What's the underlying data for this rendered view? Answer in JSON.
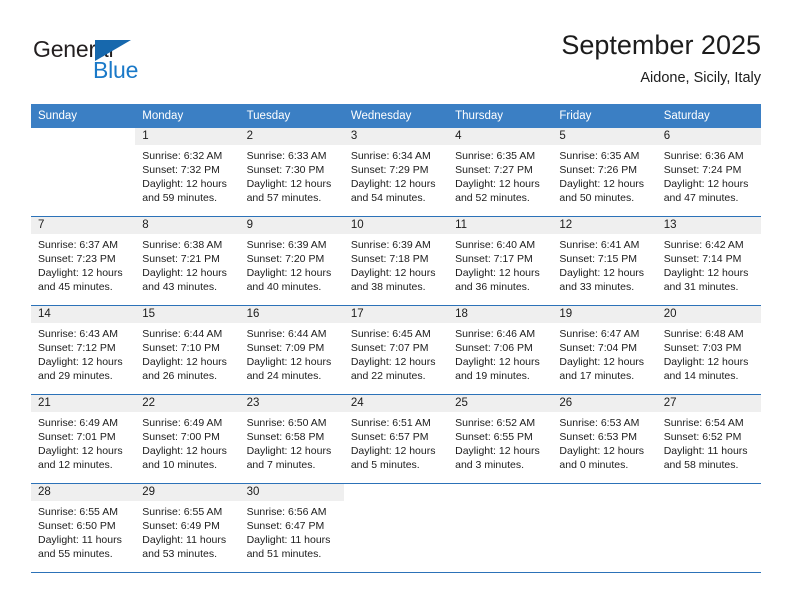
{
  "brand": {
    "name_dark": "General",
    "name_blue": "Blue",
    "accent_color": "#1a79c8",
    "triangle_color": "#1768ad"
  },
  "header": {
    "title": "September 2025",
    "location": "Aidone, Sicily, Italy"
  },
  "theme": {
    "header_bg": "#3b7fc4",
    "header_text": "#ffffff",
    "daynum_bg": "#efefef",
    "row_divider": "#2c72b8",
    "body_text": "#1c1c1c"
  },
  "weekday_headers": [
    "Sunday",
    "Monday",
    "Tuesday",
    "Wednesday",
    "Thursday",
    "Friday",
    "Saturday"
  ],
  "weeks": [
    [
      {
        "day": "",
        "sunrise": "",
        "sunset": "",
        "daylight1": "",
        "daylight2": ""
      },
      {
        "day": "1",
        "sunrise": "Sunrise: 6:32 AM",
        "sunset": "Sunset: 7:32 PM",
        "daylight1": "Daylight: 12 hours",
        "daylight2": "and 59 minutes."
      },
      {
        "day": "2",
        "sunrise": "Sunrise: 6:33 AM",
        "sunset": "Sunset: 7:30 PM",
        "daylight1": "Daylight: 12 hours",
        "daylight2": "and 57 minutes."
      },
      {
        "day": "3",
        "sunrise": "Sunrise: 6:34 AM",
        "sunset": "Sunset: 7:29 PM",
        "daylight1": "Daylight: 12 hours",
        "daylight2": "and 54 minutes."
      },
      {
        "day": "4",
        "sunrise": "Sunrise: 6:35 AM",
        "sunset": "Sunset: 7:27 PM",
        "daylight1": "Daylight: 12 hours",
        "daylight2": "and 52 minutes."
      },
      {
        "day": "5",
        "sunrise": "Sunrise: 6:35 AM",
        "sunset": "Sunset: 7:26 PM",
        "daylight1": "Daylight: 12 hours",
        "daylight2": "and 50 minutes."
      },
      {
        "day": "6",
        "sunrise": "Sunrise: 6:36 AM",
        "sunset": "Sunset: 7:24 PM",
        "daylight1": "Daylight: 12 hours",
        "daylight2": "and 47 minutes."
      }
    ],
    [
      {
        "day": "7",
        "sunrise": "Sunrise: 6:37 AM",
        "sunset": "Sunset: 7:23 PM",
        "daylight1": "Daylight: 12 hours",
        "daylight2": "and 45 minutes."
      },
      {
        "day": "8",
        "sunrise": "Sunrise: 6:38 AM",
        "sunset": "Sunset: 7:21 PM",
        "daylight1": "Daylight: 12 hours",
        "daylight2": "and 43 minutes."
      },
      {
        "day": "9",
        "sunrise": "Sunrise: 6:39 AM",
        "sunset": "Sunset: 7:20 PM",
        "daylight1": "Daylight: 12 hours",
        "daylight2": "and 40 minutes."
      },
      {
        "day": "10",
        "sunrise": "Sunrise: 6:39 AM",
        "sunset": "Sunset: 7:18 PM",
        "daylight1": "Daylight: 12 hours",
        "daylight2": "and 38 minutes."
      },
      {
        "day": "11",
        "sunrise": "Sunrise: 6:40 AM",
        "sunset": "Sunset: 7:17 PM",
        "daylight1": "Daylight: 12 hours",
        "daylight2": "and 36 minutes."
      },
      {
        "day": "12",
        "sunrise": "Sunrise: 6:41 AM",
        "sunset": "Sunset: 7:15 PM",
        "daylight1": "Daylight: 12 hours",
        "daylight2": "and 33 minutes."
      },
      {
        "day": "13",
        "sunrise": "Sunrise: 6:42 AM",
        "sunset": "Sunset: 7:14 PM",
        "daylight1": "Daylight: 12 hours",
        "daylight2": "and 31 minutes."
      }
    ],
    [
      {
        "day": "14",
        "sunrise": "Sunrise: 6:43 AM",
        "sunset": "Sunset: 7:12 PM",
        "daylight1": "Daylight: 12 hours",
        "daylight2": "and 29 minutes."
      },
      {
        "day": "15",
        "sunrise": "Sunrise: 6:44 AM",
        "sunset": "Sunset: 7:10 PM",
        "daylight1": "Daylight: 12 hours",
        "daylight2": "and 26 minutes."
      },
      {
        "day": "16",
        "sunrise": "Sunrise: 6:44 AM",
        "sunset": "Sunset: 7:09 PM",
        "daylight1": "Daylight: 12 hours",
        "daylight2": "and 24 minutes."
      },
      {
        "day": "17",
        "sunrise": "Sunrise: 6:45 AM",
        "sunset": "Sunset: 7:07 PM",
        "daylight1": "Daylight: 12 hours",
        "daylight2": "and 22 minutes."
      },
      {
        "day": "18",
        "sunrise": "Sunrise: 6:46 AM",
        "sunset": "Sunset: 7:06 PM",
        "daylight1": "Daylight: 12 hours",
        "daylight2": "and 19 minutes."
      },
      {
        "day": "19",
        "sunrise": "Sunrise: 6:47 AM",
        "sunset": "Sunset: 7:04 PM",
        "daylight1": "Daylight: 12 hours",
        "daylight2": "and 17 minutes."
      },
      {
        "day": "20",
        "sunrise": "Sunrise: 6:48 AM",
        "sunset": "Sunset: 7:03 PM",
        "daylight1": "Daylight: 12 hours",
        "daylight2": "and 14 minutes."
      }
    ],
    [
      {
        "day": "21",
        "sunrise": "Sunrise: 6:49 AM",
        "sunset": "Sunset: 7:01 PM",
        "daylight1": "Daylight: 12 hours",
        "daylight2": "and 12 minutes."
      },
      {
        "day": "22",
        "sunrise": "Sunrise: 6:49 AM",
        "sunset": "Sunset: 7:00 PM",
        "daylight1": "Daylight: 12 hours",
        "daylight2": "and 10 minutes."
      },
      {
        "day": "23",
        "sunrise": "Sunrise: 6:50 AM",
        "sunset": "Sunset: 6:58 PM",
        "daylight1": "Daylight: 12 hours",
        "daylight2": "and 7 minutes."
      },
      {
        "day": "24",
        "sunrise": "Sunrise: 6:51 AM",
        "sunset": "Sunset: 6:57 PM",
        "daylight1": "Daylight: 12 hours",
        "daylight2": "and 5 minutes."
      },
      {
        "day": "25",
        "sunrise": "Sunrise: 6:52 AM",
        "sunset": "Sunset: 6:55 PM",
        "daylight1": "Daylight: 12 hours",
        "daylight2": "and 3 minutes."
      },
      {
        "day": "26",
        "sunrise": "Sunrise: 6:53 AM",
        "sunset": "Sunset: 6:53 PM",
        "daylight1": "Daylight: 12 hours",
        "daylight2": "and 0 minutes."
      },
      {
        "day": "27",
        "sunrise": "Sunrise: 6:54 AM",
        "sunset": "Sunset: 6:52 PM",
        "daylight1": "Daylight: 11 hours",
        "daylight2": "and 58 minutes."
      }
    ],
    [
      {
        "day": "28",
        "sunrise": "Sunrise: 6:55 AM",
        "sunset": "Sunset: 6:50 PM",
        "daylight1": "Daylight: 11 hours",
        "daylight2": "and 55 minutes."
      },
      {
        "day": "29",
        "sunrise": "Sunrise: 6:55 AM",
        "sunset": "Sunset: 6:49 PM",
        "daylight1": "Daylight: 11 hours",
        "daylight2": "and 53 minutes."
      },
      {
        "day": "30",
        "sunrise": "Sunrise: 6:56 AM",
        "sunset": "Sunset: 6:47 PM",
        "daylight1": "Daylight: 11 hours",
        "daylight2": "and 51 minutes."
      },
      {
        "day": "",
        "sunrise": "",
        "sunset": "",
        "daylight1": "",
        "daylight2": ""
      },
      {
        "day": "",
        "sunrise": "",
        "sunset": "",
        "daylight1": "",
        "daylight2": ""
      },
      {
        "day": "",
        "sunrise": "",
        "sunset": "",
        "daylight1": "",
        "daylight2": ""
      },
      {
        "day": "",
        "sunrise": "",
        "sunset": "",
        "daylight1": "",
        "daylight2": ""
      }
    ]
  ]
}
